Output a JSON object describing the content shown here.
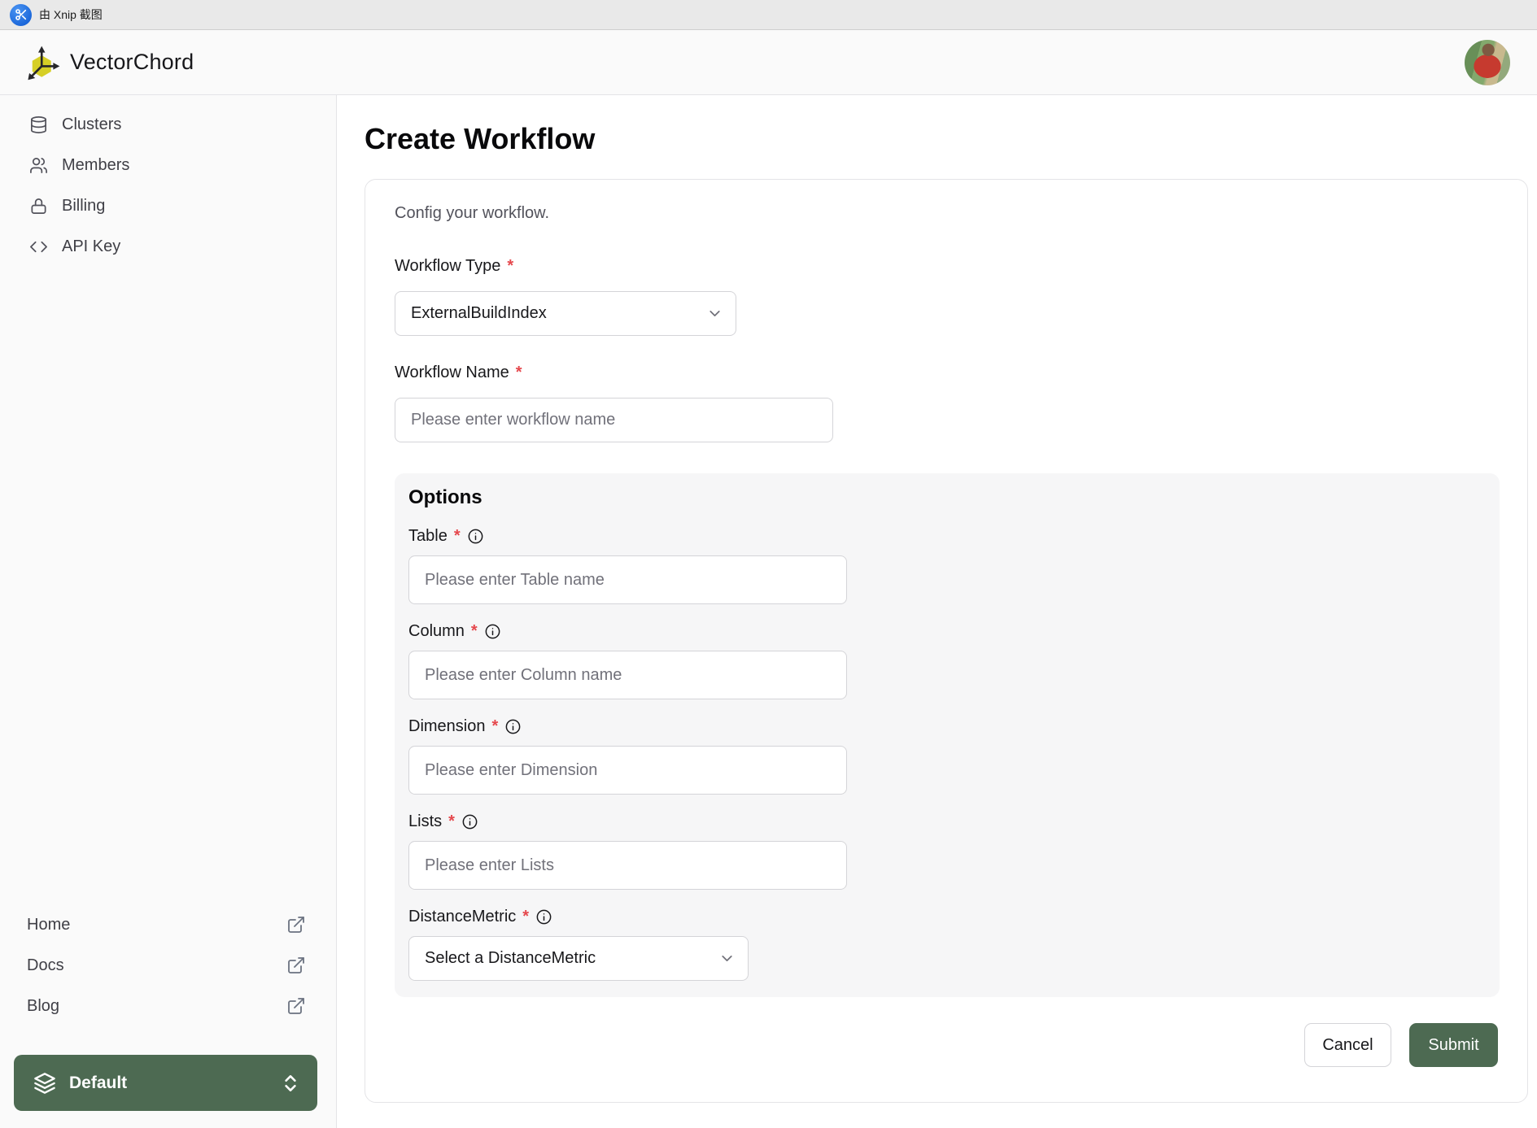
{
  "xnip_bar": {
    "label": "由 Xnip 截图"
  },
  "header": {
    "brand": "VectorChord"
  },
  "sidebar": {
    "items": [
      {
        "icon": "database-icon",
        "label": "Clusters"
      },
      {
        "icon": "users-icon",
        "label": "Members"
      },
      {
        "icon": "lock-icon",
        "label": "Billing"
      },
      {
        "icon": "code-icon",
        "label": "API Key"
      }
    ],
    "footer_links": [
      {
        "icon": "external-link-icon",
        "label": "Home"
      },
      {
        "icon": "external-link-icon",
        "label": "Docs"
      },
      {
        "icon": "external-link-icon",
        "label": "Blog"
      }
    ],
    "project_switcher": {
      "icon": "layers-icon",
      "label": "Default"
    }
  },
  "main": {
    "title": "Create Workflow",
    "card": {
      "description": "Config your workflow.",
      "required_marker": "*",
      "workflow_type": {
        "label": "Workflow Type",
        "value": "ExternalBuildIndex"
      },
      "workflow_name": {
        "label": "Workflow Name",
        "placeholder": "Please enter workflow name"
      },
      "options": {
        "title": "Options",
        "fields": [
          {
            "label": "Table",
            "placeholder": "Please enter Table name",
            "type": "text"
          },
          {
            "label": "Column",
            "placeholder": "Please enter Column name",
            "type": "text"
          },
          {
            "label": "Dimension",
            "placeholder": "Please enter Dimension",
            "type": "text"
          },
          {
            "label": "Lists",
            "placeholder": "Please enter Lists",
            "type": "text"
          },
          {
            "label": "DistanceMetric",
            "placeholder": "Select a DistanceMetric",
            "type": "select"
          }
        ]
      },
      "buttons": {
        "cancel": "Cancel",
        "submit": "Submit"
      }
    }
  },
  "colors": {
    "accent_green": "#4d6a52",
    "asterisk_red": "#e5484d",
    "logo_yellow": "#d6cf26",
    "xnip_blue": "#1a66d9"
  }
}
